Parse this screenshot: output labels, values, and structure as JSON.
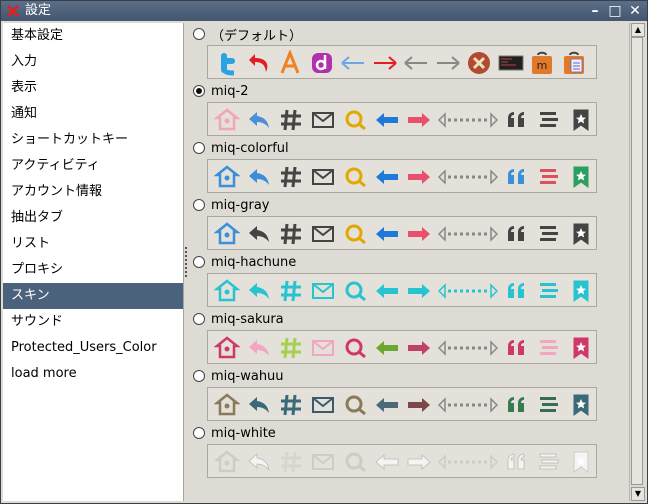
{
  "window": {
    "title": "設定"
  },
  "sidebar": {
    "items": [
      {
        "label": "基本設定"
      },
      {
        "label": "入力"
      },
      {
        "label": "表示"
      },
      {
        "label": "通知"
      },
      {
        "label": "ショートカットキー"
      },
      {
        "label": "アクティビティ"
      },
      {
        "label": "アカウント情報"
      },
      {
        "label": "抽出タブ"
      },
      {
        "label": "リスト"
      },
      {
        "label": "プロキシ"
      },
      {
        "label": "スキン"
      },
      {
        "label": "サウンド"
      },
      {
        "label": "Protected_Users_Color"
      },
      {
        "label": "load more"
      }
    ],
    "selected_index": 10
  },
  "skins": [
    {
      "name": "（デフォルト）",
      "selected": false,
      "style": "default"
    },
    {
      "name": "miq-2",
      "selected": true,
      "style": "miq2"
    },
    {
      "name": "miq-colorful",
      "selected": false,
      "style": "colorful"
    },
    {
      "name": "miq-gray",
      "selected": false,
      "style": "gray"
    },
    {
      "name": "miq-hachune",
      "selected": false,
      "style": "hachune"
    },
    {
      "name": "miq-sakura",
      "selected": false,
      "style": "sakura"
    },
    {
      "name": "miq-wahuu",
      "selected": false,
      "style": "wahuu"
    },
    {
      "name": "miq-white",
      "selected": false,
      "style": "white"
    }
  ],
  "default_icons": [
    "twitter-icon",
    "undo-icon",
    "letter-a-icon",
    "letter-d-icon",
    "arrow-left-icon",
    "arrow-right-icon",
    "arrow-left-gray-icon",
    "arrow-right-gray-icon",
    "close-circle-icon",
    "terminal-icon",
    "mikutter-bag-icon",
    "document-bag-icon"
  ],
  "skin_icons": [
    "home-icon",
    "reply-icon",
    "hashtag-icon",
    "mail-icon",
    "search-icon",
    "arrow-left-icon",
    "arrow-right-icon",
    "dotted-arrow-icon",
    "quote-icon",
    "list-icon",
    "bookmark-icon"
  ],
  "palettes": {
    "miq2": {
      "home": "#f2a6b6",
      "reply": "#4a90d9",
      "hash": "#444444",
      "mail": "#444444",
      "search": "#e0a800",
      "left": "#1e7ad8",
      "right": "#e8506e",
      "dots": "#888888",
      "quote": "#444444",
      "list": "#444444",
      "bookmark": "#444444"
    },
    "colorful": {
      "home": "#3a8fd8",
      "reply": "#3a8fd8",
      "hash": "#444444",
      "mail": "#444444",
      "search": "#e0a800",
      "left": "#1e7ad8",
      "right": "#e8506e",
      "dots": "#888888",
      "quote": "#3a8fd8",
      "list": "#e0505a",
      "bookmark": "#2aa060"
    },
    "gray": {
      "home": "#3a8fd8",
      "reply": "#444444",
      "hash": "#444444",
      "mail": "#444444",
      "search": "#e0a800",
      "left": "#1e7ad8",
      "right": "#e8506e",
      "dots": "#888888",
      "quote": "#444444",
      "list": "#444444",
      "bookmark": "#444444"
    },
    "hachune": {
      "home": "#27c4d0",
      "reply": "#27c4d0",
      "hash": "#27c4d0",
      "mail": "#27c4d0",
      "search": "#27c4d0",
      "left": "#27c4d0",
      "right": "#27c4d0",
      "dots": "#27c4d0",
      "quote": "#27c4d0",
      "list": "#27c4d0",
      "bookmark": "#27c4d0"
    },
    "sakura": {
      "home": "#d0386a",
      "reply": "#f2a6c4",
      "hash": "#a8d050",
      "mail": "#f2a6c4",
      "search": "#d0386a",
      "left": "#6aa830",
      "right": "#c04068",
      "dots": "#888888",
      "quote": "#d0386a",
      "list": "#f2a6c4",
      "bookmark": "#d0386a"
    },
    "wahuu": {
      "home": "#8a7a5a",
      "reply": "#3a6a78",
      "hash": "#3a6a78",
      "mail": "#3a5a70",
      "search": "#8a7a5a",
      "left": "#4a6a78",
      "right": "#7a4848",
      "dots": "#888888",
      "quote": "#3a7a50",
      "list": "#3a6a58",
      "bookmark": "#3a6a78"
    },
    "white": {
      "home": "#f4f4f4",
      "reply": "#f4f4f4",
      "hash": "#f4f4f4",
      "mail": "#f4f4f4",
      "search": "#f4f4f4",
      "left": "#f4f4f4",
      "right": "#f4f4f4",
      "dots": "#f4f4f4",
      "quote": "#f4f4f4",
      "list": "#f4f4f4",
      "bookmark": "#f4f4f4"
    }
  }
}
